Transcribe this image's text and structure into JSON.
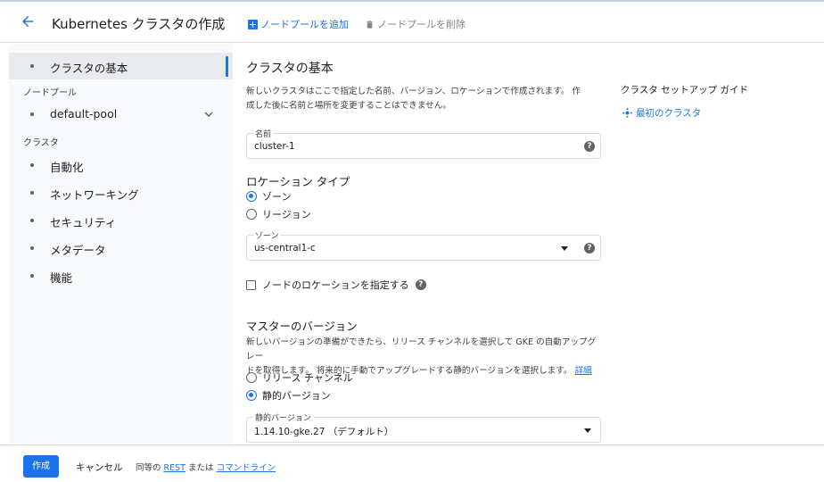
{
  "header": {
    "title": "Kubernetes クラスタの作成",
    "add_node_pool": "ノードプールを追加",
    "delete_node_pool": "ノードプールを削除"
  },
  "sidebar": {
    "basics": "クラスタの基本",
    "section_node_pools": "ノードプール",
    "default_pool": "default-pool",
    "section_cluster": "クラスタ",
    "items": [
      "自動化",
      "ネットワーキング",
      "セキュリティ",
      "メタデータ",
      "機能"
    ]
  },
  "main": {
    "heading": "クラスタの基本",
    "description_line1": "新しいクラスタはここで指定した名前、バージョン、ロケーションで作成されます。 作",
    "description_line2": "成した後に名前と場所を変更することはできません。",
    "name_field": {
      "label": "名前",
      "value": "cluster-1"
    },
    "location_type": {
      "heading": "ロケーション タイプ",
      "options": [
        "ゾーン",
        "リージョン"
      ],
      "selected": "ゾーン"
    },
    "zone_field": {
      "label": "ゾーン",
      "value": "us-central1-c"
    },
    "node_locations_checkbox": {
      "label": "ノードのロケーションを指定する",
      "checked": false
    },
    "master_version": {
      "heading": "マスターのバージョン",
      "desc_line1": "新しいバージョンの準備ができたら、リリース チャンネルを選択して GKE の自動アップグレー",
      "desc_line2": "ドを取得します。 将来的に手動でアップグレードする静的バージョンを選択します。",
      "details_link": "詳細",
      "options": [
        "リリース チャンネル",
        "静的バージョン"
      ],
      "selected": "静的バージョン"
    },
    "static_version_field": {
      "label": "静的バージョン",
      "value": "1.14.10-gke.27 （デフォルト）"
    }
  },
  "guide": {
    "title": "クラスタ セットアップ ガイド",
    "link": "最初のクラスタ"
  },
  "footer": {
    "create": "作成",
    "cancel": "キャンセル",
    "equivalent_prefix": "同等の",
    "rest": "REST",
    "or": "または",
    "command_line": "コマンドライン"
  },
  "colors": {
    "accent": "#1a73e8",
    "sidebar_bg": "#f8f9fa",
    "active_bg": "#e8eaed"
  }
}
